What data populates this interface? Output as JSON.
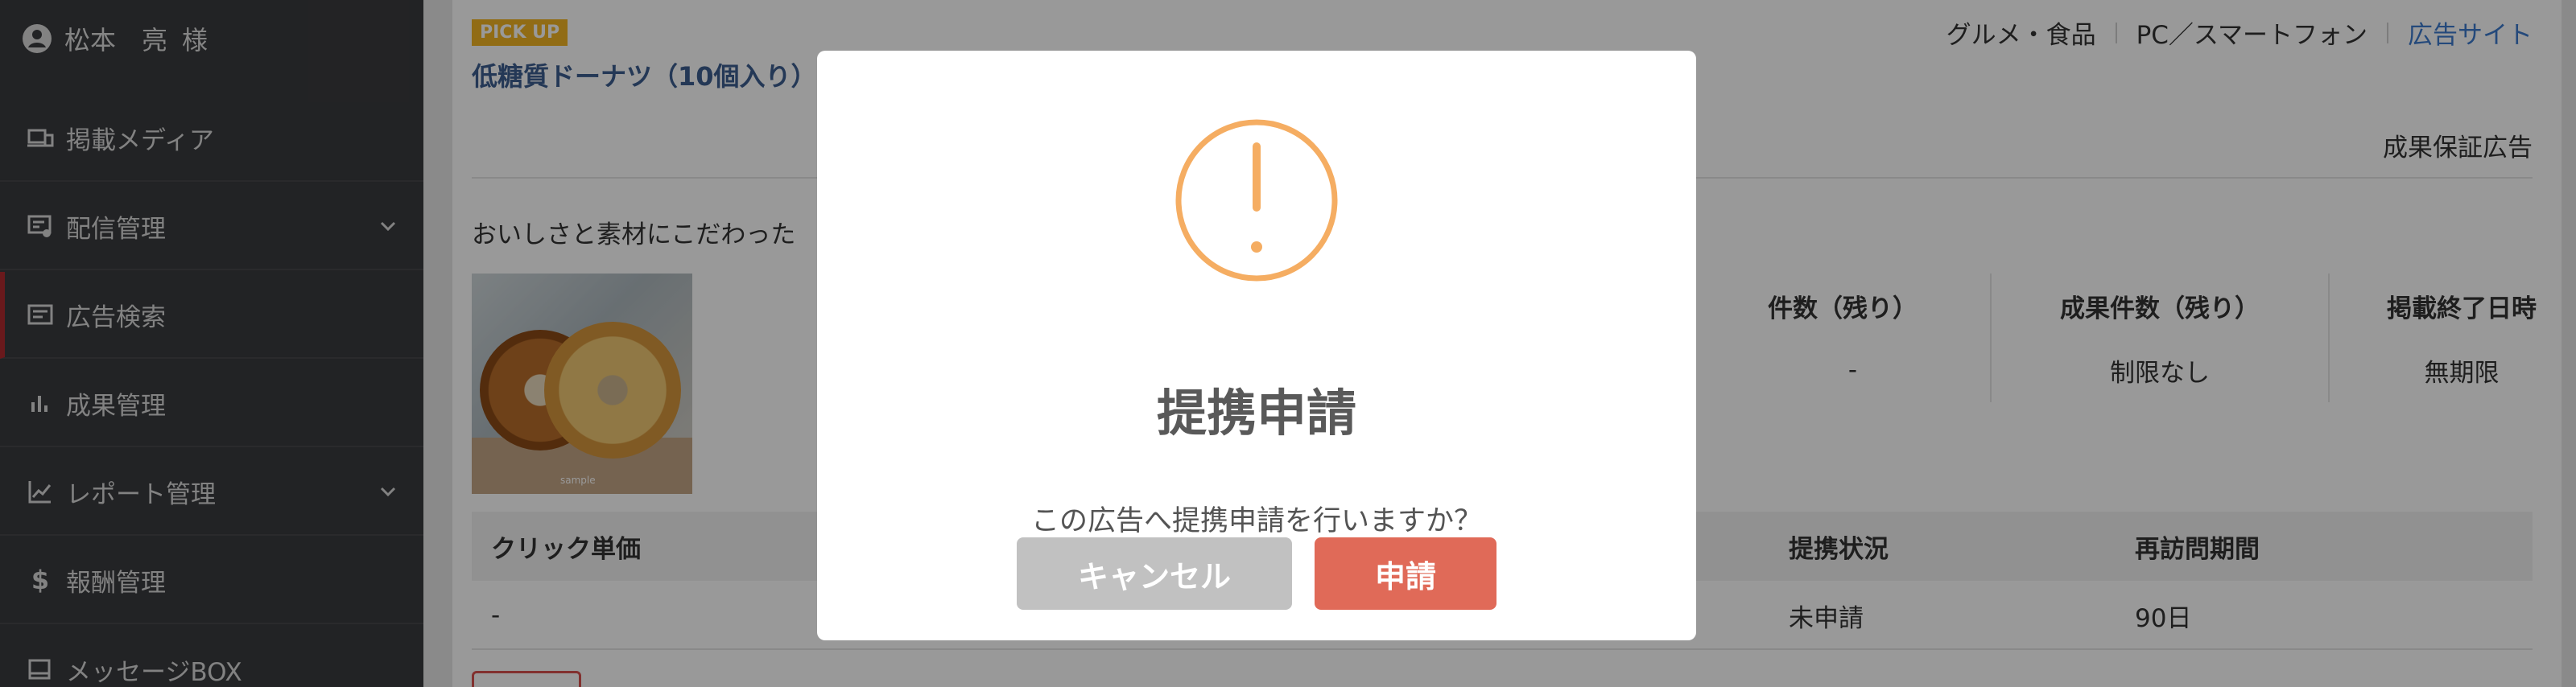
{
  "sidebar": {
    "user": {
      "name": "松本　亮",
      "honorific": "様"
    },
    "items": [
      {
        "label": "掲載メディア",
        "icon": "media-icon"
      },
      {
        "label": "配信管理",
        "icon": "delivery-icon",
        "expandable": true
      },
      {
        "label": "広告検索",
        "icon": "ad-search-icon",
        "active": true
      },
      {
        "label": "成果管理",
        "icon": "bar-chart-icon"
      },
      {
        "label": "レポート管理",
        "icon": "line-chart-icon",
        "expandable": true
      },
      {
        "label": "報酬管理",
        "icon": "dollar-icon"
      },
      {
        "label": "メッセージBOX",
        "icon": "message-icon"
      }
    ]
  },
  "ad": {
    "badge": "PICK UP",
    "title": "低糖質ドーナツ（10個入り）",
    "categories": [
      "グルメ・食品",
      "PC／スマートフォン"
    ],
    "site_link": "広告サイト",
    "type": "成果保証広告",
    "description": "おいしさと素材にこだわった",
    "image_label": "sample",
    "stats": [
      {
        "header": "件数（残り）",
        "value": "-"
      },
      {
        "header": "成果件数（残り）",
        "value": "制限なし"
      },
      {
        "header": "掲載終了日時",
        "value": "無期限"
      }
    ],
    "table": {
      "headers": [
        "クリック単価",
        "提携状況",
        "再訪問期間"
      ],
      "row": [
        "-",
        "未申請",
        "90日"
      ]
    }
  },
  "dialog": {
    "icon": "warning-icon",
    "title": "提携申請",
    "message": "この広告へ提携申請を行いますか？",
    "cancel_label": "キャンセル",
    "confirm_label": "申請"
  },
  "colors": {
    "sidebar_bg": "#3a3b3e",
    "active_marker": "#b12a2f",
    "warning": "#f5ad62",
    "confirm_button": "#e06a58",
    "cancel_button": "#c1c1c1",
    "link": "#3d7bcd",
    "badge": "#f2b524"
  }
}
